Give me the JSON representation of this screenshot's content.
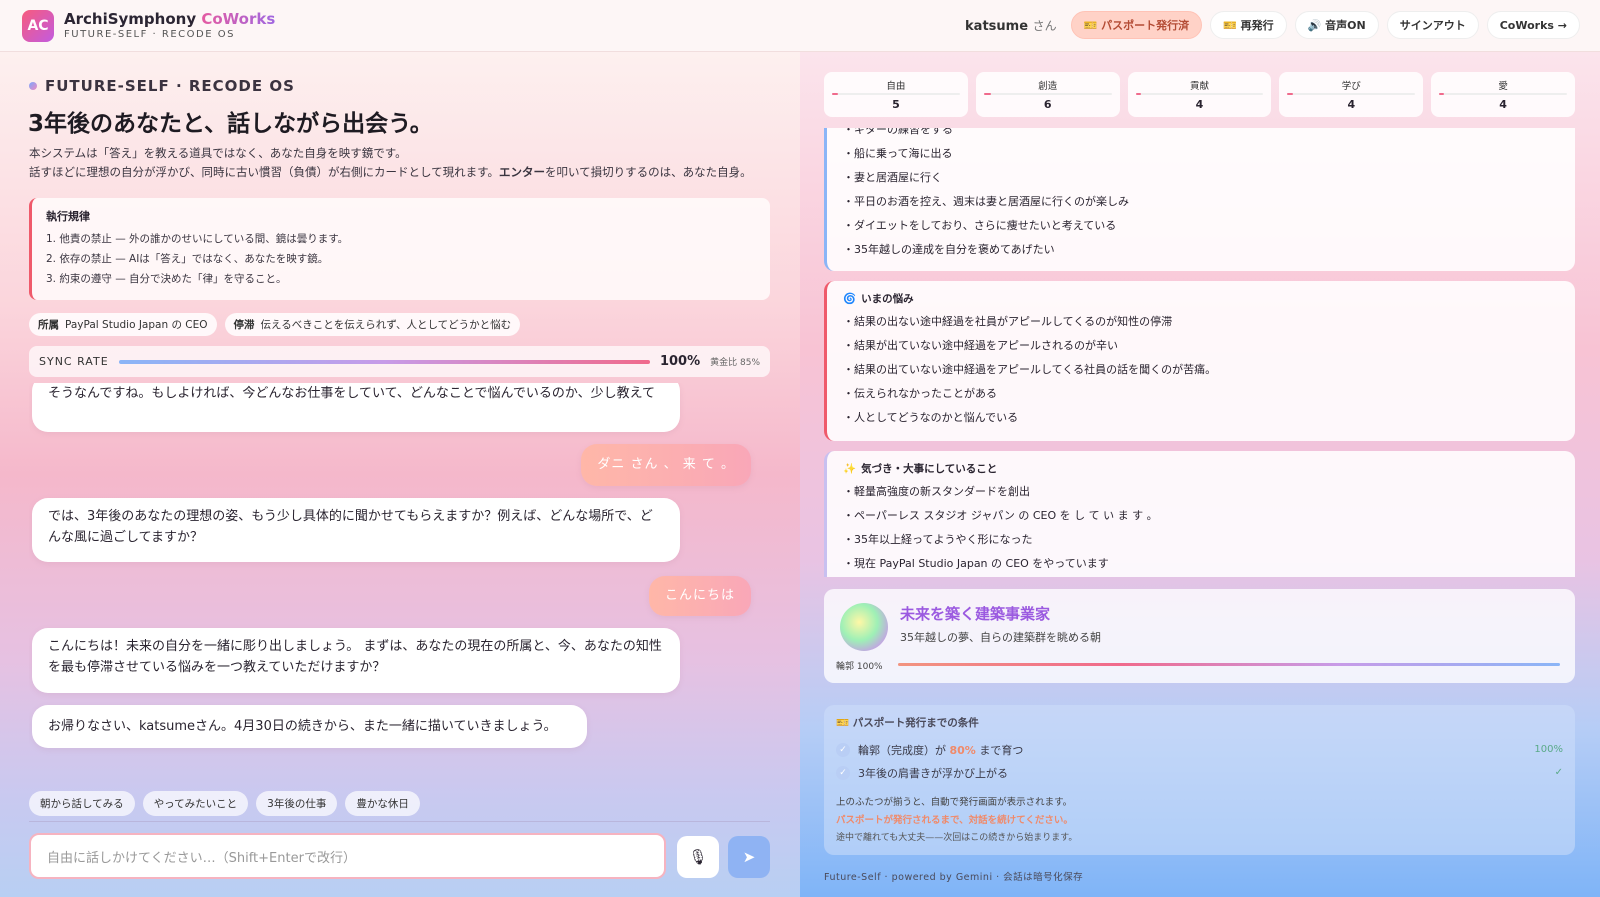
{
  "header": {
    "logo": "AC",
    "brand_main": "ArchiSymphony",
    "brand_accent": "CoWorks",
    "brand_sub": "FUTURE-SELF · RECODE OS",
    "user": "katsume",
    "user_suffix": "さん",
    "btn_passport": "🎫 パスポート発行済",
    "btn_reissue": "🎫 再発行",
    "btn_voice": "🔊 音声ON",
    "btn_signout": "サインアウト",
    "btn_coworks": "CoWorks →"
  },
  "left": {
    "kicker": "FUTURE-SELF · RECODE OS",
    "title": "3年後のあなたと、話しながら出会う。",
    "desc1": "本システムは「答え」を教える道具ではなく、あなた自身を映す鏡です。",
    "desc2a": "話すほどに理想の自分が浮かび、同時に古い慣習（負債）が右側にカードとして現れます。",
    "desc2b": "エンター",
    "desc2c": "を叩いて損切りするのは、あなた自身。",
    "rules_title": "執行規律",
    "rules": [
      "1. 他責の禁止 — 外の誰かのせいにしている間、鏡は曇ります。",
      "2. 依存の禁止 — AIは「答え」ではなく、あなたを映す鏡。",
      "3. 約束の遵守 — 自分で決めた「律」を守ること。"
    ],
    "chip1_label": "所属",
    "chip1_value": "PayPal Studio Japan の CEO",
    "chip2_label": "停滞",
    "chip2_value": "伝えるべきことを伝えられず、人としてどうかと悩む",
    "sync_label": "SYNC RATE",
    "sync_value": "100%",
    "sync_gold": "黄金比 85%",
    "messages": [
      "そうなんですね。もしよければ、今どんなお仕事をしていて、どんなことで悩んでいるのか、少し教えて",
      "ダニ さん 、 来 て 。",
      "では、3年後のあなたの理想の姿、もう少し具体的に聞かせてもらえますか？例えば、どんな場所で、どんな風に過ごしてますか？",
      "こんにちは",
      "こんにちは！未来の自分を一緒に彫り出しましょう。 まずは、あなたの現在の所属と、今、あなたの知性を最も停滞させている悩みを一つ教えていただけますか？",
      "お帰りなさい、katsumeさん。4月30日の続きから、また一緒に描いていきましょう。"
    ],
    "quick": [
      "朝から話してみる",
      "やってみたいこと",
      "3年後の仕事",
      "豊かな休日"
    ],
    "input_placeholder": "自由に話しかけてください…（Shift+Enterで改行）",
    "mic": "🎙",
    "send": "➤"
  },
  "right": {
    "stats": [
      {
        "name": "自由",
        "value": "5",
        "level": 0.05
      },
      {
        "name": "創造",
        "value": "6",
        "level": 0.06
      },
      {
        "name": "貢献",
        "value": "4",
        "level": 0.04
      },
      {
        "name": "学び",
        "value": "4",
        "level": 0.04
      },
      {
        "name": "愛",
        "value": "4",
        "level": 0.04
      }
    ],
    "card1_items": [
      "・ギターの練習をする",
      "・船に乗って海に出る",
      "・妻と居酒屋に行く",
      "・平日のお酒を控え、週末は妻と居酒屋に行くのが楽しみ",
      "・ダイエットをしており、さらに痩せたいと考えている",
      "・35年越しの達成を自分を褒めてあげたい"
    ],
    "card2_title": "いまの悩み",
    "card2_icon": "🌀",
    "card2_items": [
      "・結果の出ない途中経過を社員がアピールしてくるのが知性の停滞",
      "・結果が出ていない途中経過をアピールされるのが辛い",
      "・結果の出ていない途中経過をアピールしてくる社員の話を聞くのが苦痛。",
      "・伝えられなかったことがある",
      "・人としてどうなのかと悩んでいる"
    ],
    "card3_title": "気づき・大事にしていること",
    "card3_icon": "✨",
    "card3_items": [
      "・軽量高強度の新スタンダードを創出",
      "・ペーパーレス スタジオ ジャパン の CEO を し て い ま す 。",
      "・35年以上経ってようやく形になった",
      "・現在 PayPal Studio Japan の CEO をやっています"
    ],
    "future_title": "未来を築く建築事業家",
    "future_sub": "35年越しの夢、自らの建築群を眺める朝",
    "outline_label": "輪郭 100%",
    "cond_title": "🎫 パスポート発行までの条件",
    "cond1a": "輪郭（完成度）が ",
    "cond1b": "80%",
    "cond1c": " まで育つ",
    "cond1_value": "100%",
    "cond2": "3年後の肩書きが浮かび上がる",
    "cond2_value": "✓",
    "note1": "上のふたつが揃うと、自動で発行画面が表示されます。",
    "note2": "パスポートが発行されるまで、対話を続けてください。",
    "note3": "途中で離れても大丈夫——次回はこの続きから始まります。",
    "footer": "Future-Self · powered by Gemini · 会話は暗号化保存"
  },
  "colors": {
    "accent_pink": "#f06a8c",
    "accent_blue": "#8ab5f7",
    "accent_purple": "#9b5ae0"
  }
}
